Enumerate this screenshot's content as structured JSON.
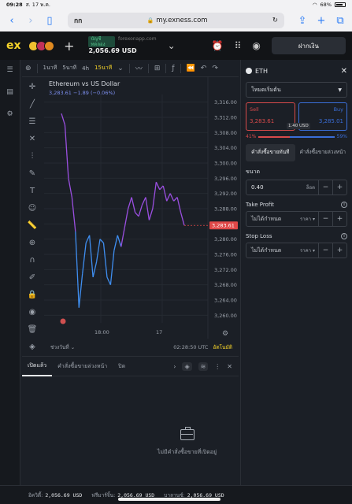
{
  "status": {
    "time": "09:28",
    "date": "ส. 17 พ.ค.",
    "battery": "68%"
  },
  "safari": {
    "aa": "กก",
    "host": "my.exness.com"
  },
  "header": {
    "logo": "ex",
    "account_tag": "บัญชีทดลอง",
    "server": "forexonapp.com",
    "balance": "2,056.69 USD",
    "deposit_label": "ฝากเงิน",
    "flag_colors": [
      "#f0c030",
      "#c0305a",
      "#e08a20"
    ]
  },
  "chart_toolbar": {
    "timeframes": [
      "1นาที",
      "5นาที",
      "4h",
      "15นาที"
    ],
    "active_timeframe": "15นาที"
  },
  "chart": {
    "symbol": "Ethereum vs US Dollar",
    "quote": "3,283.61  −1.89  (−0.06%)",
    "last_price_label": "3,283.61",
    "time_range_label": "ช่วงวันที่",
    "clock": "02:28:50 UTC",
    "auto_label": "อัตโนมัติ"
  },
  "chart_data": {
    "type": "line",
    "title": "Ethereum vs US Dollar",
    "xlabel": "",
    "ylabel": "",
    "x_ticks": [
      "18:00",
      "17"
    ],
    "y_ticks": [
      "3,316.00",
      "3,312.00",
      "3,308.00",
      "3,304.00",
      "3,300.00",
      "3,296.00",
      "3,292.00",
      "3,288.00",
      "3,284.00",
      "3,280.00",
      "3,276.00",
      "3,272.00",
      "3,268.00",
      "3,264.00",
      "3,260.00"
    ],
    "ylim": [
      3258,
      3318
    ],
    "values": [
      3313,
      3310,
      3296,
      3291,
      3282,
      3262,
      3271,
      3279,
      3281,
      3270,
      3274,
      3280,
      3279,
      3270,
      3268,
      3277,
      3281,
      3278,
      3283,
      3288,
      3291,
      3287,
      3286,
      3289,
      3291,
      3285,
      3288,
      3295,
      3293,
      3294,
      3290,
      3292,
      3290,
      3291,
      3287,
      3283.61
    ],
    "colors": {
      "up": "#9a4fe0",
      "down": "#3f8ef0"
    }
  },
  "trade_panel": {
    "symbol": "ETH",
    "mode": "โหมดเริ่มต้น",
    "sell_label": "Sell",
    "sell_price": "3,283.61",
    "buy_label": "Buy",
    "buy_price": "3,285.01",
    "spread": "1.40 USD",
    "sell_ratio": "41%",
    "buy_ratio": "59%",
    "order_types": [
      "คำสั่งซื้อขายทันที",
      "คำสั่งซื้อขายล่วงหน้า"
    ],
    "volume_label": "ขนาด",
    "volume": "0.40",
    "volume_unit": "ล็อต",
    "tp_label": "Take Profit",
    "sl_label": "Stop Loss",
    "not_set": "ไม่ได้กำหนด",
    "price_unit": "ราคา"
  },
  "bottom": {
    "tabs": [
      "เปิดแล้ว",
      "คำสั่งซื้อขายล่วงหน้า",
      "ปิด"
    ],
    "empty": "ไม่มีคำสั่งซื้อขายที่เปิดอยู่"
  },
  "footer": {
    "equity_label": "อิควิตี้:",
    "equity": "2,056.69 USD",
    "free_margin_label": "ฟรีมาร์จิ้น:",
    "free_margin": "2,056.69 USD",
    "balance_label": "บาลานซ์:",
    "balance": "2,056.69 USD"
  }
}
